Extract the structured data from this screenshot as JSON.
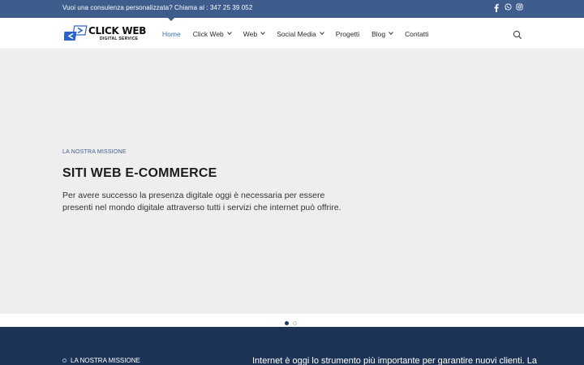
{
  "topbar": {
    "text": "Vuoi una consulenza personalizzata? Chiama al : 347 25 39 052",
    "social": [
      "facebook-icon",
      "whatsapp-icon",
      "instagram-icon"
    ]
  },
  "logo": {
    "title": "CLICK WEB",
    "subtitle": "DIGITAL SERVICE"
  },
  "menu": {
    "items": [
      {
        "label": "Home",
        "active": true,
        "dropdown": false
      },
      {
        "label": "Click Web",
        "active": false,
        "dropdown": true
      },
      {
        "label": "Web",
        "active": false,
        "dropdown": true
      },
      {
        "label": "Social Media",
        "active": false,
        "dropdown": true
      },
      {
        "label": "Progetti",
        "active": false,
        "dropdown": false
      },
      {
        "label": "Blog",
        "active": false,
        "dropdown": true
      },
      {
        "label": "Contatti",
        "active": false,
        "dropdown": false
      }
    ]
  },
  "hero": {
    "eyebrow": "LA NOSTRA MISSIONE",
    "title": "SITI WEB E-COMMERCE",
    "description": "Per avere successo la presenza digitale oggi è necessaria per essere presenti nel mondo digitale attraverso tutti i servizi che internet può offrire."
  },
  "slider": {
    "active_index": 0,
    "count": 2
  },
  "band": {
    "eyebrow": "LA NOSTRA MISSIONE",
    "text": "Internet è oggi lo strumento più importante per garantire nuovi clienti. La"
  },
  "colors": {
    "topbar": "#3e5d8c",
    "accent": "#3e6fb5",
    "band": "#1e3456",
    "hero_bg": "#eeeeee"
  }
}
